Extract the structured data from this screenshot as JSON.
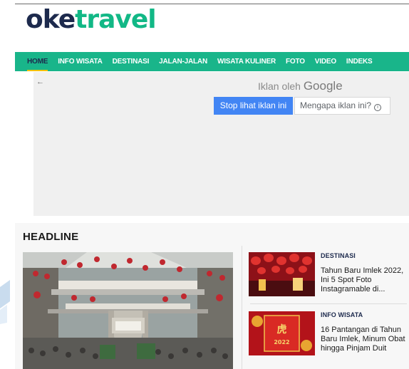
{
  "logo": {
    "part1": "oke",
    "part2": "travel"
  },
  "nav": {
    "items": [
      "HOME",
      "INFO WISATA",
      "DESTINASI",
      "JALAN-JALAN",
      "WISATA KULINER",
      "FOTO",
      "VIDEO",
      "INDEKS"
    ],
    "active_index": 0
  },
  "ad": {
    "by_text": "Iklan oleh",
    "brand": "Google",
    "stop_label": "Stop lihat iklan ini",
    "why_label": "Mengapa iklan ini?",
    "accent": "#4285f4"
  },
  "headline": {
    "title": "HEADLINE",
    "side": [
      {
        "category": "DESTINASI",
        "title": "Tahun Baru Imlek 2022, Ini 5 Spot Foto Instagramable di..."
      },
      {
        "category": "INFO WISATA",
        "title": "16 Pantangan di Tahun Baru Imlek, Minum Obat hingga Pinjam Duit",
        "thumb_text": "2022"
      }
    ]
  },
  "colors": {
    "brand_green": "#19b58a",
    "brand_navy": "#1d2a4d",
    "active_underline": "#f4c20d"
  }
}
